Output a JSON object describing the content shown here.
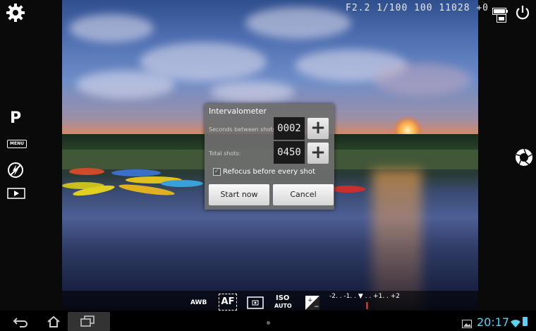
{
  "top_status": {
    "readout": "F2.2  1/100  100  11028 +0"
  },
  "left_bar": {
    "mode_label": "P",
    "menu_label": "MENU"
  },
  "dialog": {
    "title": "Intervalometer",
    "seconds_label": "Seconds between shots:",
    "seconds_value": "0002",
    "total_label": "Total shots:",
    "total_value": "0450",
    "plus_label": "+",
    "refocus_label": "Refocus before every shot",
    "refocus_checked": true,
    "start_label": "Start now",
    "cancel_label": "Cancel"
  },
  "toolbar": {
    "awb": "AWB",
    "af": "AF",
    "iso_top": "ISO",
    "iso_bottom": "AUTO",
    "ev_scale": "-2. . -1. . ▼ . . +1. . +2"
  },
  "navbar": {
    "clock": "20:17"
  },
  "colors": {
    "clock": "#5fd0f0",
    "ev_marker": "#e02020"
  },
  "icons": [
    "gear-icon",
    "menu-icon",
    "flash-off-icon",
    "playback-icon",
    "power-icon",
    "battery-icon",
    "sdcard-icon",
    "shutter-icon",
    "exposure-icon",
    "ev-compensation-icon",
    "back-icon",
    "home-icon",
    "recent-apps-icon",
    "gallery-icon",
    "wifi-icon"
  ]
}
